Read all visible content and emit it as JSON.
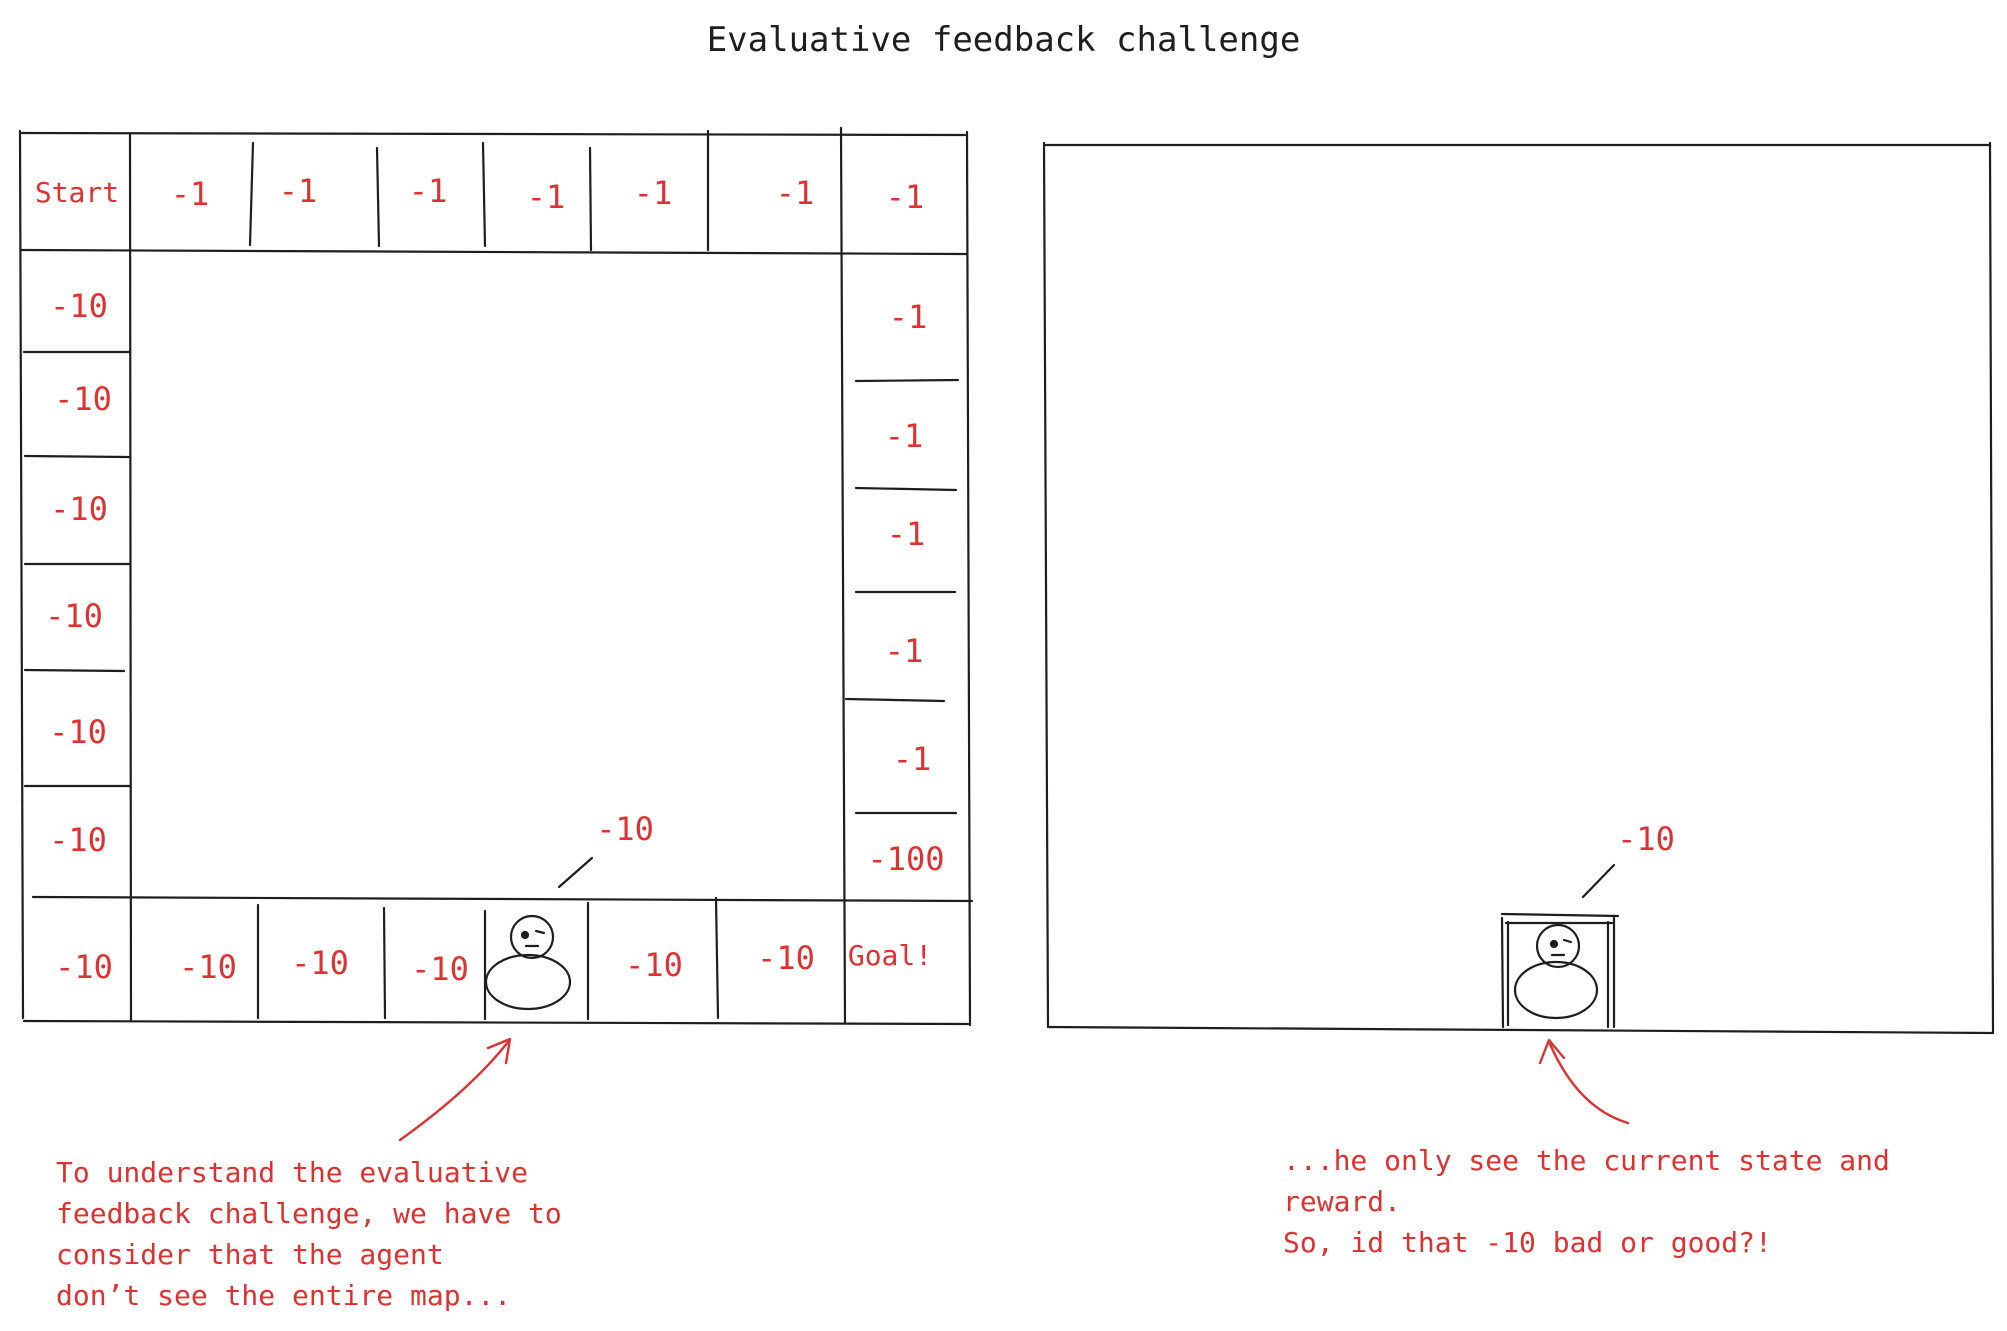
{
  "title": "Evaluative feedback challenge",
  "colors": {
    "ink": "#1e1e1e",
    "accent": "#e03131"
  },
  "full_map": {
    "top_row": [
      "Start",
      "-1",
      "-1",
      "-1",
      "-1",
      "-1",
      "-1",
      "-1"
    ],
    "left_column": [
      "-10",
      "-10",
      "-10",
      "-10",
      "-10",
      "-10"
    ],
    "right_column": [
      "-1",
      "-1",
      "-1",
      "-1",
      "-1",
      "-100"
    ],
    "bottom_row": [
      "-10",
      "-10",
      "-10",
      "-10",
      "",
      "-10",
      "-10",
      "Goal!"
    ],
    "agent_reward": "-10",
    "agent_icon": "stick-figure-agent-icon"
  },
  "agent_view": {
    "agent_reward": "-10",
    "agent_icon": "stick-figure-agent-icon"
  },
  "notes": {
    "left": "To understand the evaluative\nfeedback challenge, we have to\nconsider that the agent\ndon’t see the entire map...",
    "right": "...he only see the current state and reward.\nSo, id that -10 bad or good?!"
  }
}
